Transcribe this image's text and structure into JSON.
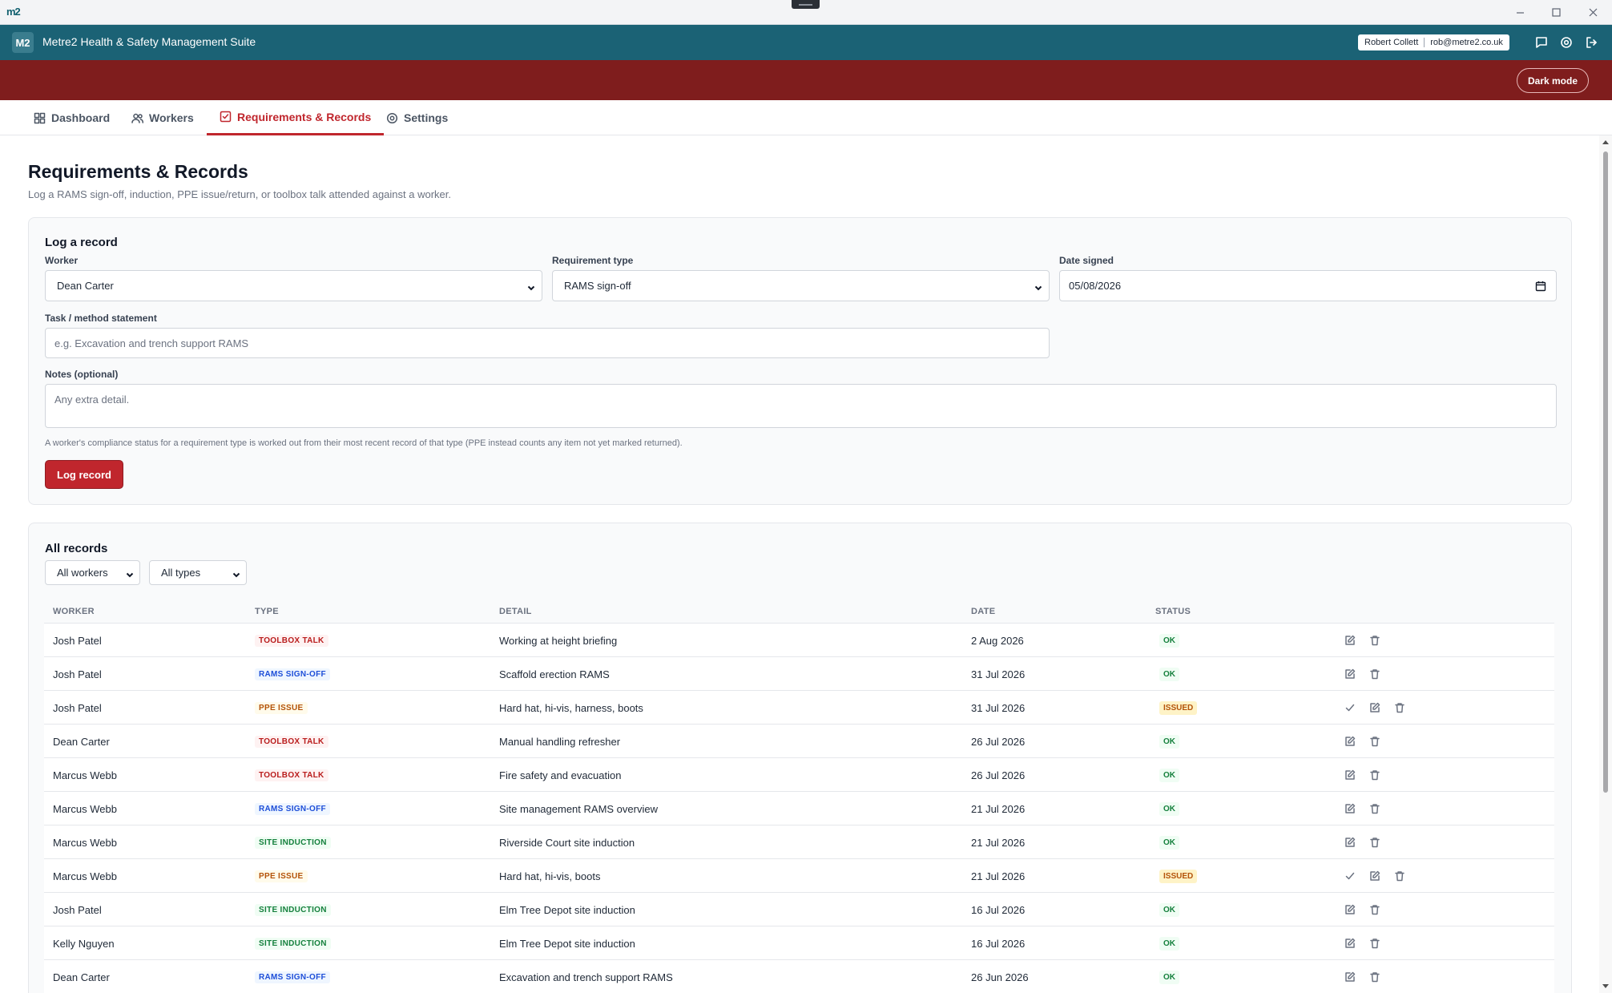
{
  "os": {
    "logo": "m2"
  },
  "header": {
    "badge": "M2",
    "title": "Metre2 Health & Safety Management Suite",
    "user_name": "Robert Collett",
    "user_email": "rob@metre2.co.uk",
    "icons": [
      "chat-icon",
      "gear-icon",
      "logout-icon"
    ]
  },
  "banner": {
    "dark_mode_label": "Dark mode"
  },
  "tabs": [
    {
      "label": "Dashboard",
      "icon": "dashboard-icon",
      "active": false
    },
    {
      "label": "Workers",
      "icon": "users-icon",
      "active": false
    },
    {
      "label": "Requirements & Records",
      "icon": "checklist-icon",
      "active": true
    },
    {
      "label": "Settings",
      "icon": "gear-icon",
      "active": false
    }
  ],
  "page": {
    "title": "Requirements & Records",
    "subtitle": "Log a RAMS sign-off, induction, PPE issue/return, or toolbox talk attended against a worker."
  },
  "log_form": {
    "heading": "Log a record",
    "worker_label": "Worker",
    "worker_value": "Dean Carter",
    "type_label": "Requirement type",
    "type_value": "RAMS sign-off",
    "date_label": "Date signed",
    "date_value": "05/08/2026",
    "task_label": "Task / method statement",
    "task_placeholder": "e.g. Excavation and trench support RAMS",
    "notes_label": "Notes (optional)",
    "notes_placeholder": "Any extra detail.",
    "hint": "A worker's compliance status for a requirement type is worked out from their most recent record of that type (PPE instead counts any item not yet marked returned).",
    "submit_label": "Log record"
  },
  "records": {
    "heading": "All records",
    "filter_worker": "All workers",
    "filter_type": "All types",
    "columns": [
      "WORKER",
      "TYPE",
      "DETAIL",
      "DATE",
      "STATUS"
    ],
    "rows": [
      {
        "worker": "Josh Patel",
        "type": "TOOLBOX TALK",
        "kind": "toolbox",
        "detail": "Working at height briefing",
        "date": "2 Aug 2026",
        "status": "OK"
      },
      {
        "worker": "Josh Patel",
        "type": "RAMS SIGN-OFF",
        "kind": "rams",
        "detail": "Scaffold erection RAMS",
        "date": "31 Jul 2026",
        "status": "OK"
      },
      {
        "worker": "Josh Patel",
        "type": "PPE ISSUE",
        "kind": "ppe",
        "detail": "Hard hat, hi-vis, harness, boots",
        "date": "31 Jul 2026",
        "status": "ISSUED"
      },
      {
        "worker": "Dean Carter",
        "type": "TOOLBOX TALK",
        "kind": "toolbox",
        "detail": "Manual handling refresher",
        "date": "26 Jul 2026",
        "status": "OK"
      },
      {
        "worker": "Marcus Webb",
        "type": "TOOLBOX TALK",
        "kind": "toolbox",
        "detail": "Fire safety and evacuation",
        "date": "26 Jul 2026",
        "status": "OK"
      },
      {
        "worker": "Marcus Webb",
        "type": "RAMS SIGN-OFF",
        "kind": "rams",
        "detail": "Site management RAMS overview",
        "date": "21 Jul 2026",
        "status": "OK"
      },
      {
        "worker": "Marcus Webb",
        "type": "SITE INDUCTION",
        "kind": "site",
        "detail": "Riverside Court site induction",
        "date": "21 Jul 2026",
        "status": "OK"
      },
      {
        "worker": "Marcus Webb",
        "type": "PPE ISSUE",
        "kind": "ppe",
        "detail": "Hard hat, hi-vis, boots",
        "date": "21 Jul 2026",
        "status": "ISSUED"
      },
      {
        "worker": "Josh Patel",
        "type": "SITE INDUCTION",
        "kind": "site",
        "detail": "Elm Tree Depot site induction",
        "date": "16 Jul 2026",
        "status": "OK"
      },
      {
        "worker": "Kelly Nguyen",
        "type": "SITE INDUCTION",
        "kind": "site",
        "detail": "Elm Tree Depot site induction",
        "date": "16 Jul 2026",
        "status": "OK"
      },
      {
        "worker": "Dean Carter",
        "type": "RAMS SIGN-OFF",
        "kind": "rams",
        "detail": "Excavation and trench support RAMS",
        "date": "26 Jun 2026",
        "status": "OK"
      }
    ]
  },
  "colors": {
    "header": "#1b6275",
    "banner": "#7f1d1d",
    "accent": "#c0262d"
  }
}
